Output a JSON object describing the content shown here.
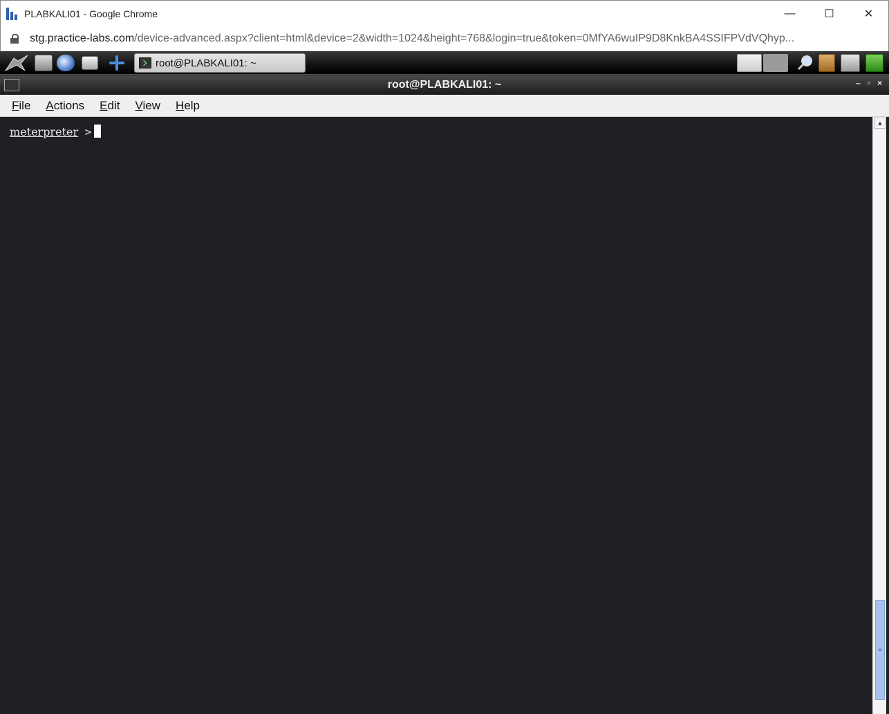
{
  "browser": {
    "window_title": "PLABKALI01 - Google Chrome",
    "url_host": "stg.practice-labs.com",
    "url_path": "/device-advanced.aspx?client=html&device=2&width=1024&height=768&login=true&token=0MfYA6wuIP9D8KnkBA4SSIFPVdVQhyp..."
  },
  "window_controls": {
    "minimize": "—",
    "maximize": "☐",
    "close": "✕"
  },
  "panel": {
    "task_label": "root@PLABKALI01: ~"
  },
  "terminal": {
    "title": "root@PLABKALI01: ~",
    "title_buttons": [
      "–",
      "▫",
      "×"
    ],
    "menu": [
      "File",
      "Actions",
      "Edit",
      "View",
      "Help"
    ],
    "prompt": "meterpreter",
    "prompt_symbol": ">"
  },
  "scrollbar": {
    "up_arrow": "▲",
    "thumb_grip": "≡"
  }
}
